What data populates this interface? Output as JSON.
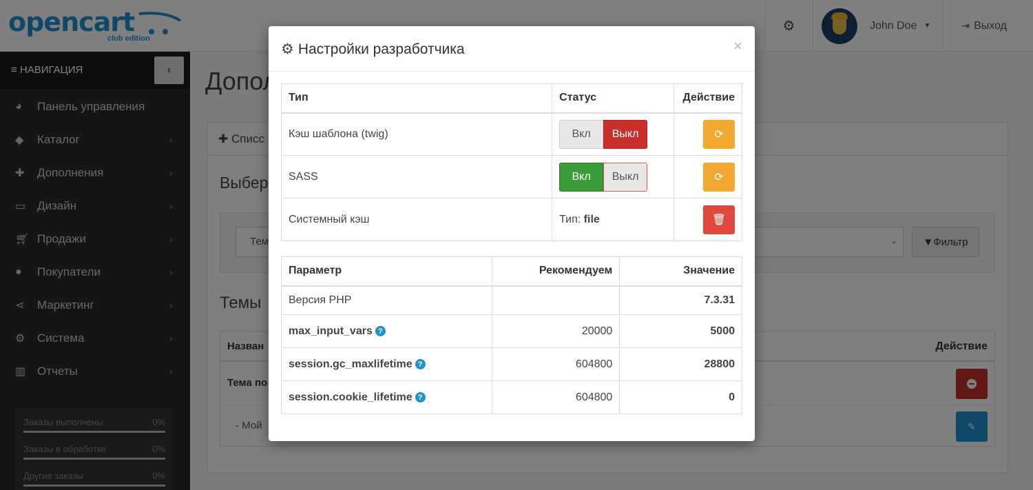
{
  "header": {
    "logo_text": "opencart",
    "logo_sub": "club edition",
    "user_name": "John Doe",
    "logout_label": "Выход"
  },
  "sidebar": {
    "nav_label": "НАВИГАЦИЯ",
    "items": [
      {
        "label": "Панель управления",
        "icon": "dashboard-icon",
        "has_children": false
      },
      {
        "label": "Каталог",
        "icon": "tags-icon",
        "has_children": true
      },
      {
        "label": "Дополнения",
        "icon": "puzzle-icon",
        "has_children": true
      },
      {
        "label": "Дизайн",
        "icon": "monitor-icon",
        "has_children": true
      },
      {
        "label": "Продажи",
        "icon": "cart-icon",
        "has_children": true
      },
      {
        "label": "Покупатели",
        "icon": "user-icon",
        "has_children": true
      },
      {
        "label": "Маркетинг",
        "icon": "share-icon",
        "has_children": true
      },
      {
        "label": "Система",
        "icon": "gear-icon",
        "has_children": true
      },
      {
        "label": "Отчеты",
        "icon": "bar-chart-icon",
        "has_children": true
      }
    ],
    "stats": [
      {
        "label": "Заказы выполнены",
        "value": "0%"
      },
      {
        "label": "Заказы в обработке",
        "value": "0%"
      },
      {
        "label": "Другие заказы",
        "value": "0%"
      }
    ]
  },
  "main": {
    "page_title": "Допол",
    "panel_title": "Списс",
    "select_label": "Выбер",
    "filter_placeholder": "Тем",
    "filter_button": "Фильтр",
    "themes_title": "Темы",
    "col_name": "Назван",
    "col_action": "Действие",
    "row1_name": "Тема по",
    "row2_name": "-  Мой"
  },
  "modal": {
    "title": "Настройки разработчика",
    "cache_table": {
      "headers": {
        "type": "Тип",
        "status": "Статус",
        "action": "Действие"
      },
      "rows": [
        {
          "type": "Кэш шаблона (twig)",
          "on_label": "Вкл",
          "off_label": "Выкл",
          "state": "off"
        },
        {
          "type": "SASS",
          "on_label": "Вкл",
          "off_label": "Выкл",
          "state": "on"
        },
        {
          "type": "Системный кэш",
          "status_prefix": "Тип:",
          "status_value": "file"
        }
      ]
    },
    "params_table": {
      "headers": {
        "param": "Параметр",
        "recommend": "Рекомендуем",
        "value": "Значение"
      },
      "rows": [
        {
          "param": "Версия PHP",
          "recommend": "",
          "value": "7.3.31",
          "status": "ok",
          "help": false
        },
        {
          "param": "max_input_vars",
          "recommend": "20000",
          "value": "5000",
          "status": "bad",
          "help": true
        },
        {
          "param": "session.gc_maxlifetime",
          "recommend": "604800",
          "value": "28800",
          "status": "bad",
          "help": true
        },
        {
          "param": "session.cookie_lifetime",
          "recommend": "604800",
          "value": "0",
          "status": "bad",
          "help": true
        }
      ]
    }
  },
  "colors": {
    "brand_blue": "#1e91cf",
    "danger": "#c9302c",
    "success": "#3c9b39",
    "warning": "#f0a830"
  }
}
